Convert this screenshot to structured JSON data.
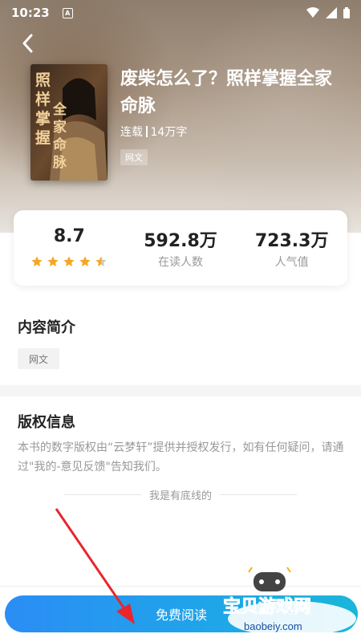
{
  "status_bar": {
    "time": "10:23",
    "indicator": "A"
  },
  "nav": {
    "back_icon": "chevron-left-icon"
  },
  "book": {
    "cover_text_main": "照样掌握全家命脉",
    "title": "废柴怎么了？照样掌握全家命脉",
    "status": "连载",
    "word_count": "14万字",
    "tag": "网文"
  },
  "stats": {
    "rating": "8.7",
    "rating_stars": 4.5,
    "readers_value": "592.8万",
    "readers_label": "在读人数",
    "popularity_value": "723.3万",
    "popularity_label": "人气值"
  },
  "intro": {
    "title": "内容简介",
    "tag": "网文"
  },
  "copyright": {
    "title": "版权信息",
    "text": "本书的数字版权由“云梦轩”提供并授权发行，如有任何疑问，请通过\"我的-意见反馈\"告知我们。",
    "bottom_line": "我是有底线的"
  },
  "action": {
    "read_label": "免费阅读"
  },
  "watermark": {
    "text": "宝贝游戏网",
    "url": "baobeiy.com"
  },
  "colors": {
    "accent": "#1fa6e8",
    "star": "#f5a623",
    "star_off": "#c8c8c8"
  }
}
